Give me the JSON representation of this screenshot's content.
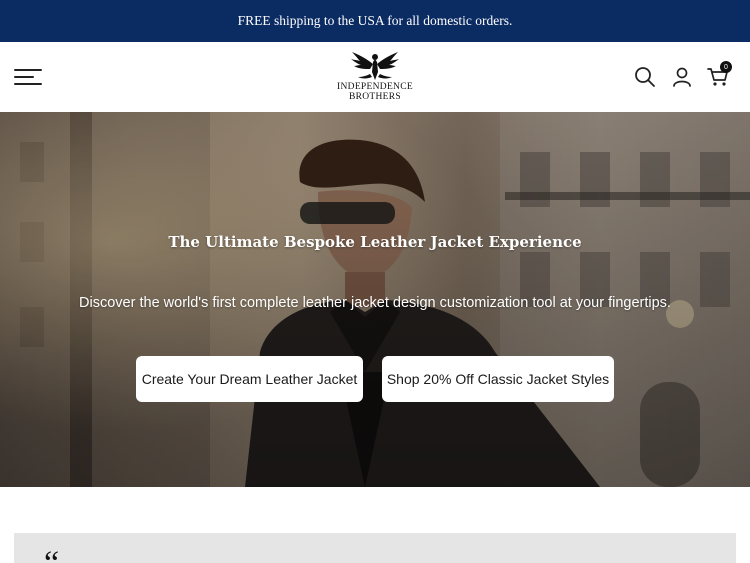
{
  "announcement": {
    "text": "FREE shipping to the USA for all domestic orders."
  },
  "header": {
    "logo_line1": "INDEPENDENCE",
    "logo_line2": "BROTHERS",
    "cart_count": "0",
    "icons": [
      "menu-icon",
      "search-icon",
      "account-icon",
      "cart-icon"
    ]
  },
  "hero": {
    "title": "The Ultimate Bespoke Leather Jacket Experience",
    "subtitle": "Discover the world's first complete leather jacket design customization tool at your fingertips.",
    "primary_button": "Create Your Dream Leather Jacket",
    "secondary_button": "Shop 20% Off Classic Jacket Styles"
  },
  "testimonial": {
    "quote_mark": "“"
  },
  "colors": {
    "announcement_bg": "#0b2b63",
    "button_bg": "#ffffff",
    "testimonial_bg": "#e5e5e5"
  }
}
